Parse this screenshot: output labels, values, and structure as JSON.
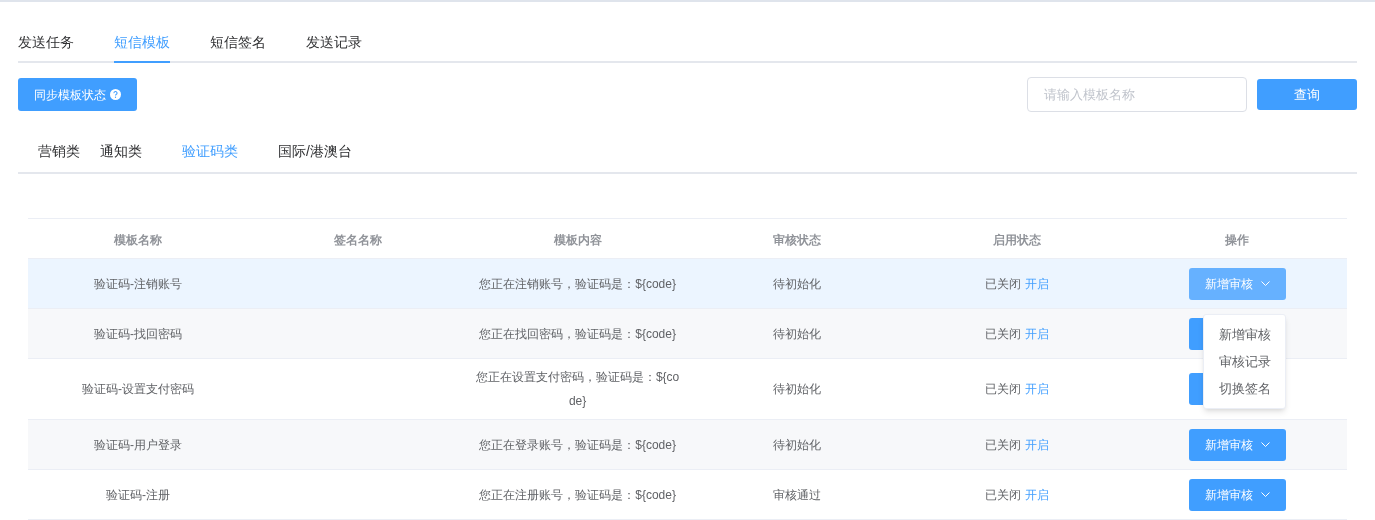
{
  "tabs": [
    {
      "label": "发送任务",
      "selected": false
    },
    {
      "label": "短信模板",
      "selected": true
    },
    {
      "label": "短信签名",
      "selected": false
    },
    {
      "label": "发送记录",
      "selected": false
    }
  ],
  "toolbar": {
    "sync_button": "同步模板状态",
    "search": {
      "placeholder": "请输入模板名称"
    },
    "query_button": "查询"
  },
  "category_tabs": [
    {
      "label": "营销类",
      "selected": false
    },
    {
      "label": "通知类",
      "selected": false
    },
    {
      "label": "验证码类",
      "selected": true
    },
    {
      "label": "国际/港澳台",
      "selected": false
    }
  ],
  "table": {
    "columns": [
      "模板名称",
      "签名名称",
      "模板内容",
      "审核状态",
      "启用状态",
      "操作"
    ],
    "rows": [
      {
        "name": "验证码-注销账号",
        "content": "您正在注销账号，验证码是：${code}",
        "review_status": "待初始化",
        "enable_status": "已关闭",
        "enable_link": "开启",
        "action": "新增审核",
        "hovered": true
      },
      {
        "name": "验证码-找回密码",
        "content": "您正在找回密码，验证码是：${code}",
        "review_status": "待初始化",
        "enable_status": "已关闭",
        "enable_link": "开启",
        "hovered": false
      },
      {
        "name": "验证码-设置支付密码",
        "content": "您正在设置支付密码，验证码是：${code}",
        "review_status": "待初始化",
        "enable_status": "已关闭",
        "enable_link": "开启",
        "hovered": false
      },
      {
        "name": "验证码-用户登录",
        "content": "您正在登录账号，验证码是：${code}",
        "review_status": "待初始化",
        "enable_status": "已关闭",
        "enable_link": "开启",
        "action": "新增审核",
        "hovered": false
      },
      {
        "name": "验证码-注册",
        "content": "您正在注册账号，验证码是：${code}",
        "review_status": "审核通过",
        "enable_status": "已关闭",
        "enable_link": "开启",
        "action": "新增审核",
        "hovered": false
      }
    ]
  },
  "dropdown_menu": {
    "items": [
      "新增审核",
      "审核记录",
      "切换签名"
    ]
  }
}
